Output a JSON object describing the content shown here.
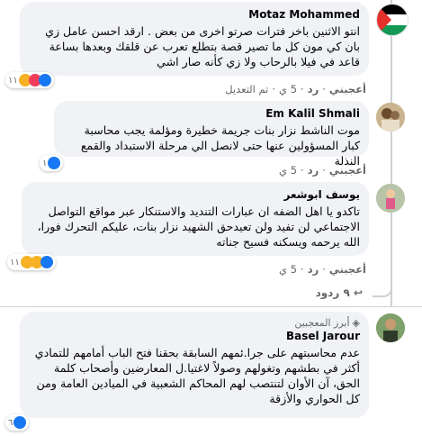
{
  "comments": [
    {
      "name": "Motaz Mohammed",
      "text": "انتو الاثنين باخر فترات صرتو اخرى من بعض . ارقد احسن عامل زي بان كي مون كل ما تصير قصة بتطلع تعرب عن قلقك وبعدها بساعة قاعد في فيلا بالرحاب ولا زي كأنه صار اشي",
      "actions": {
        "like": "أعجبني",
        "reply": "رد",
        "time": "5 ي",
        "edited": "تم التعديل"
      },
      "reaction_count": "١١"
    },
    {
      "name": "Em Kalil Shmali",
      "text": "موت الناشط نزار بنات جريمة خطيرة ومؤلمة يجب محاسبة كبار المسؤولين عنها حتى لانصل الي مرحلة الاستبداد والقمع النذلة",
      "actions": {
        "like": "أعجبني",
        "reply": "رد",
        "time": "5 ي"
      },
      "reaction_count": "١"
    },
    {
      "name": "يوسف ابوشعر",
      "text": "تاكدو يا اهل الضفه ان عبارات التنديد والاستنكار عبر مواقع التواصل الاجتماعي لن تفيد ولن تعيدحق الشهيد نزار بنات، عليكم التحرك فورا، الله يرحمه ويسكنه فسيح جناته",
      "actions": {
        "like": "أعجبني",
        "reply": "رد",
        "time": "5 ي"
      },
      "reaction_count": "١١",
      "replies": "٩ ردود"
    },
    {
      "badge": "أبرز المعجبين",
      "name": "Basel Jarour",
      "text": "عدم محاسبتهم على جرا.ئمهم السابقة بحقنا فتح الباب أمامهم للتمادي أكثر في بطشهم وتغولهم وصولاً لاغتيا.ل المعارضين وأصحاب كلمة الحق، آن الأوان لتنتصب لهم المحاكم الشعبية في الميادين العامة ومن كل الحواري والأزقة",
      "reaction_count": "٦"
    }
  ],
  "colors": {
    "bubble": "#f0f2f5",
    "meta": "#65676b",
    "like": "#1877f2",
    "love": "#f33e58",
    "haha": "#f7b125"
  }
}
